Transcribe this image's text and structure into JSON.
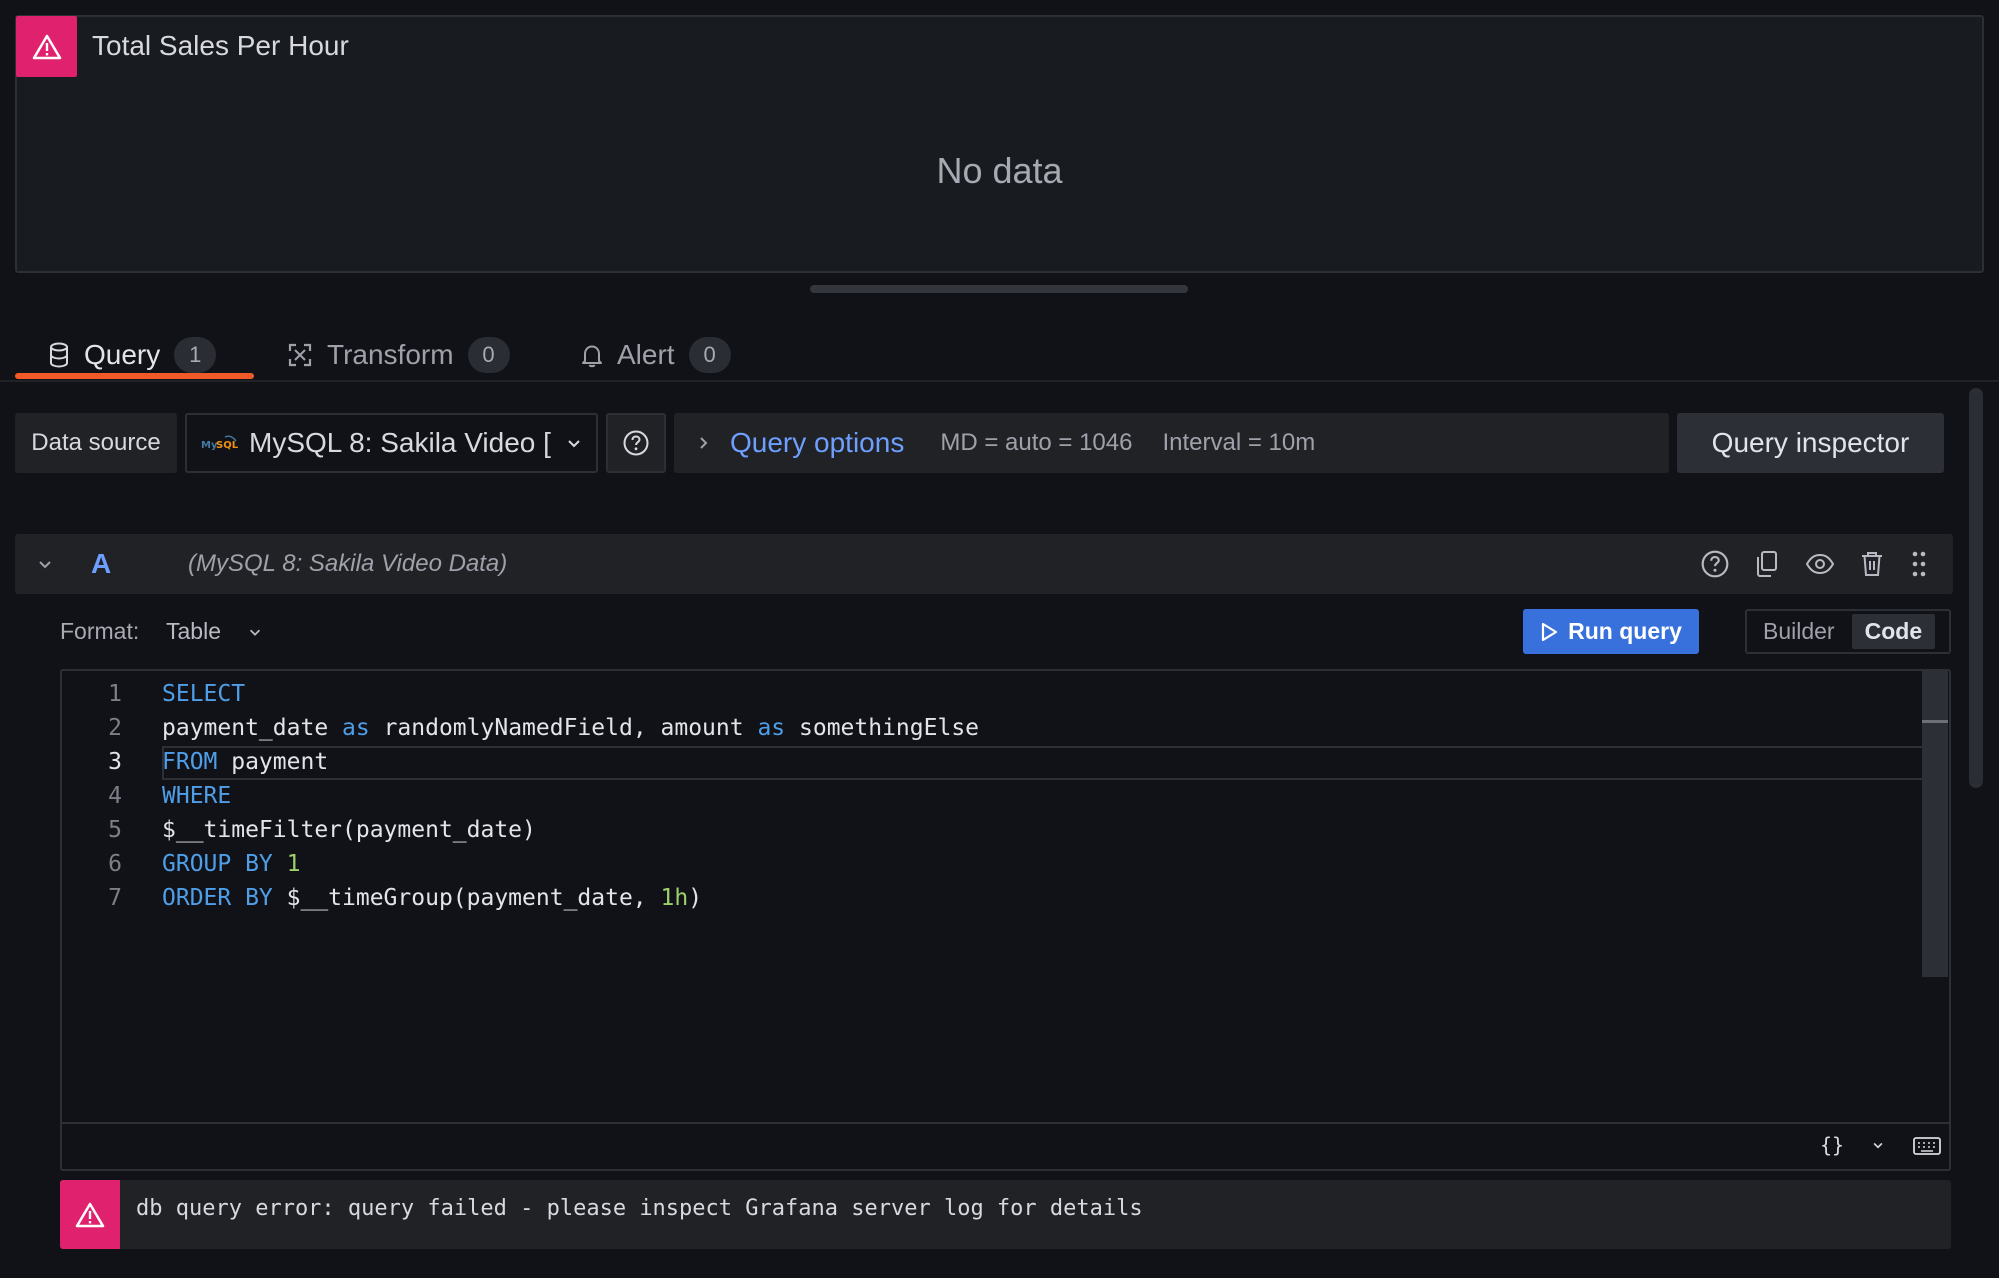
{
  "panel": {
    "title": "Total Sales Per Hour",
    "no_data": "No data",
    "alert_icon": "warning-triangle-icon"
  },
  "tabs": [
    {
      "label": "Query",
      "count": "1",
      "icon": "database-icon"
    },
    {
      "label": "Transform",
      "count": "0",
      "icon": "transform-icon"
    },
    {
      "label": "Alert",
      "count": "0",
      "icon": "bell-icon"
    }
  ],
  "toolbar": {
    "data_source_label": "Data source",
    "data_source_value": "MySQL 8: Sakila Video [",
    "query_options_title": "Query options",
    "md": "MD = auto = 1046",
    "interval": "Interval = 10m",
    "query_inspector": "Query inspector"
  },
  "query": {
    "letter": "A",
    "datasource": "(MySQL 8: Sakila Video Data)",
    "format_label": "Format:",
    "format_value": "Table",
    "run_label": "Run query",
    "mode_builder": "Builder",
    "mode_code": "Code",
    "active_line": 3,
    "lines": [
      {
        "n": "1",
        "tokens": [
          {
            "t": "SELECT",
            "c": "kw"
          }
        ]
      },
      {
        "n": "2",
        "tokens": [
          {
            "t": "payment_date "
          },
          {
            "t": "as",
            "c": "kw"
          },
          {
            "t": " randomlyNamedField, amount "
          },
          {
            "t": "as",
            "c": "kw"
          },
          {
            "t": " somethingElse"
          }
        ]
      },
      {
        "n": "3",
        "tokens": [
          {
            "t": "FROM",
            "c": "kw"
          },
          {
            "t": " payment"
          }
        ]
      },
      {
        "n": "4",
        "tokens": [
          {
            "t": "WHERE",
            "c": "kw"
          }
        ]
      },
      {
        "n": "5",
        "tokens": [
          {
            "t": "$__timeFilter(payment_date)"
          }
        ]
      },
      {
        "n": "6",
        "tokens": [
          {
            "t": "GROUP BY",
            "c": "kw"
          },
          {
            "t": " "
          },
          {
            "t": "1",
            "c": "num"
          }
        ]
      },
      {
        "n": "7",
        "tokens": [
          {
            "t": "ORDER BY",
            "c": "kw"
          },
          {
            "t": " $__timeGroup(payment_date, "
          },
          {
            "t": "1h",
            "c": "num"
          },
          {
            "t": ")"
          }
        ]
      }
    ],
    "footer_braces": "{}"
  },
  "error": {
    "message": "db query error: query failed - please inspect Grafana server log for details"
  }
}
